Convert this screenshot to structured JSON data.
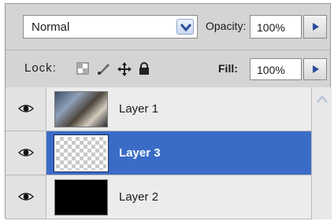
{
  "blend": {
    "mode": "Normal"
  },
  "opacity": {
    "label": "Opacity:",
    "value": "100%"
  },
  "lock": {
    "label": "Lock:"
  },
  "fill": {
    "label": "Fill:",
    "value": "100%"
  },
  "layers": [
    {
      "name": "Layer 1",
      "thumbnail": "photo",
      "visible": true,
      "selected": false
    },
    {
      "name": "Layer 3",
      "thumbnail": "transparent",
      "visible": true,
      "selected": true
    },
    {
      "name": "Layer 2",
      "thumbnail": "black",
      "visible": true,
      "selected": false
    }
  ],
  "colors": {
    "selection": "#3a6cc7",
    "panel": "#d4d4d4"
  },
  "icons": {
    "blend_dropdown": "chevron-down-icon",
    "opacity_arrow": "triangle-right-icon",
    "fill_arrow": "triangle-right-icon",
    "lock_transparent": "lock-transparent-pixels-icon",
    "lock_image": "lock-image-pixels-icon",
    "lock_position": "lock-position-icon",
    "lock_all": "lock-all-icon",
    "visibility": "eye-icon",
    "scroll_up": "scroll-up-icon"
  }
}
